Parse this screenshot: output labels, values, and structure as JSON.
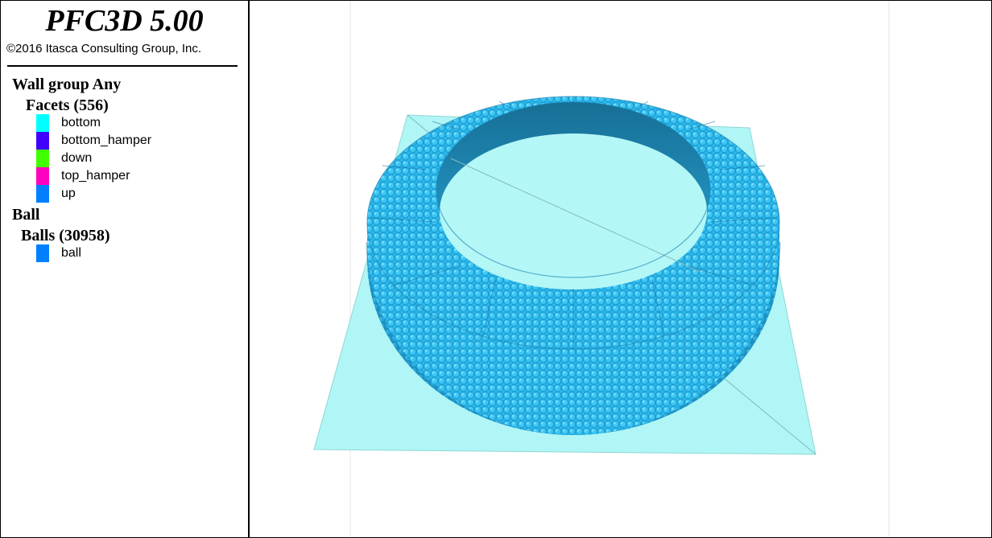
{
  "app": {
    "title": "PFC3D 5.00",
    "copyright": "©2016 Itasca Consulting Group, Inc."
  },
  "legend": {
    "wall_group": {
      "heading": "Wall group Any",
      "subheading": "Facets (556)",
      "items": [
        {
          "label": "bottom",
          "color": "#00ffff"
        },
        {
          "label": "bottom_hamper",
          "color": "#4000ff"
        },
        {
          "label": "down",
          "color": "#40ff00"
        },
        {
          "label": "top_hamper",
          "color": "#ff00c0"
        },
        {
          "label": "up",
          "color": "#0080ff"
        }
      ]
    },
    "ball": {
      "heading": "Ball",
      "subheading": "Balls (30958)",
      "items": [
        {
          "label": "ball",
          "color": "#0080ff"
        }
      ]
    }
  },
  "model": {
    "plate_color": "#b0f6f6",
    "ring_color": "#2bb8ec",
    "ring_shadow_color": "#1b8fc4",
    "inner_wall_color": "#1e86b0",
    "inner_hole_color": "#b8f8f8"
  }
}
